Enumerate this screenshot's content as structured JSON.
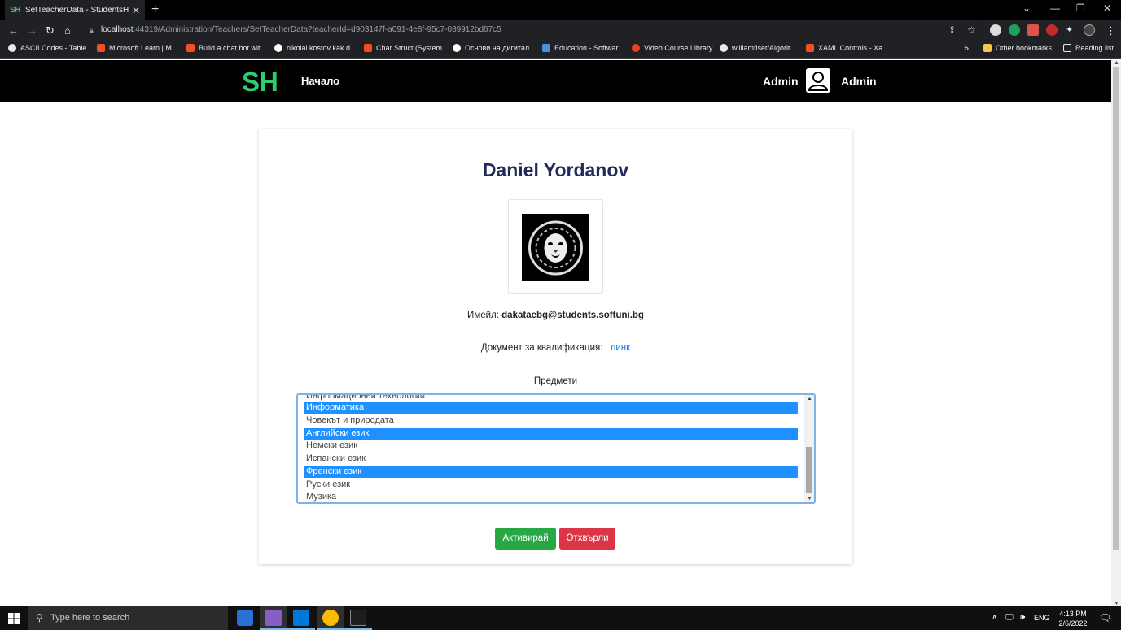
{
  "browser": {
    "tab_title": "SetTeacherData - StudentsHelper",
    "tab_favicon": "SH",
    "url_host": "localhost",
    "url_rest": ":44319/Administration/Teachers/SetTeacherData?teacherId=d903147f-a091-4e8f-95c7-089912bd67c5",
    "bookmarks": [
      "ASCII Codes - Table...",
      "Microsoft Learn | M...",
      "Build a chat bot wit...",
      "nikolai kostov kak d...",
      "Char Struct (System...",
      "Основи на дигитал...",
      "Education - Softwar...",
      "Video Course Library",
      "williamfiset/Algorit...",
      "XAML Controls - Xa..."
    ],
    "bookmarks_overflow": "»",
    "other_bookmarks": "Other bookmarks",
    "reading_list": "Reading list"
  },
  "site": {
    "logo": "SH",
    "home": "Начало",
    "user_left": "Admin",
    "user_right": "Admin"
  },
  "teacher": {
    "name": "Daniel Yordanov",
    "email_label": "Имейл:",
    "email": "dakataebg@students.softuni.bg",
    "doc_label": "Документ за квалификация:",
    "doc_link": "линк",
    "subjects_label": "Предмети",
    "subjects": [
      {
        "label": "Информационни технологии",
        "selected": false
      },
      {
        "label": "Информатика",
        "selected": true
      },
      {
        "label": "Човекът и природата",
        "selected": false
      },
      {
        "label": "Английски език",
        "selected": true
      },
      {
        "label": "Немски език",
        "selected": false
      },
      {
        "label": "Испански език",
        "selected": false
      },
      {
        "label": "Френски език",
        "selected": true
      },
      {
        "label": "Руски език",
        "selected": false
      },
      {
        "label": "Музика",
        "selected": false
      }
    ]
  },
  "actions": {
    "activate": "Активирай",
    "reject": "Отхвърли"
  },
  "taskbar": {
    "search_placeholder": "Type here to search",
    "lang": "ENG",
    "time": "4:13 PM",
    "date": "2/6/2022"
  },
  "colors": {
    "accent_green": "#2ecc71",
    "activate_btn": "#28a745",
    "reject_btn": "#dc3545",
    "selection": "#1e90ff",
    "title": "#1f2a5a"
  }
}
